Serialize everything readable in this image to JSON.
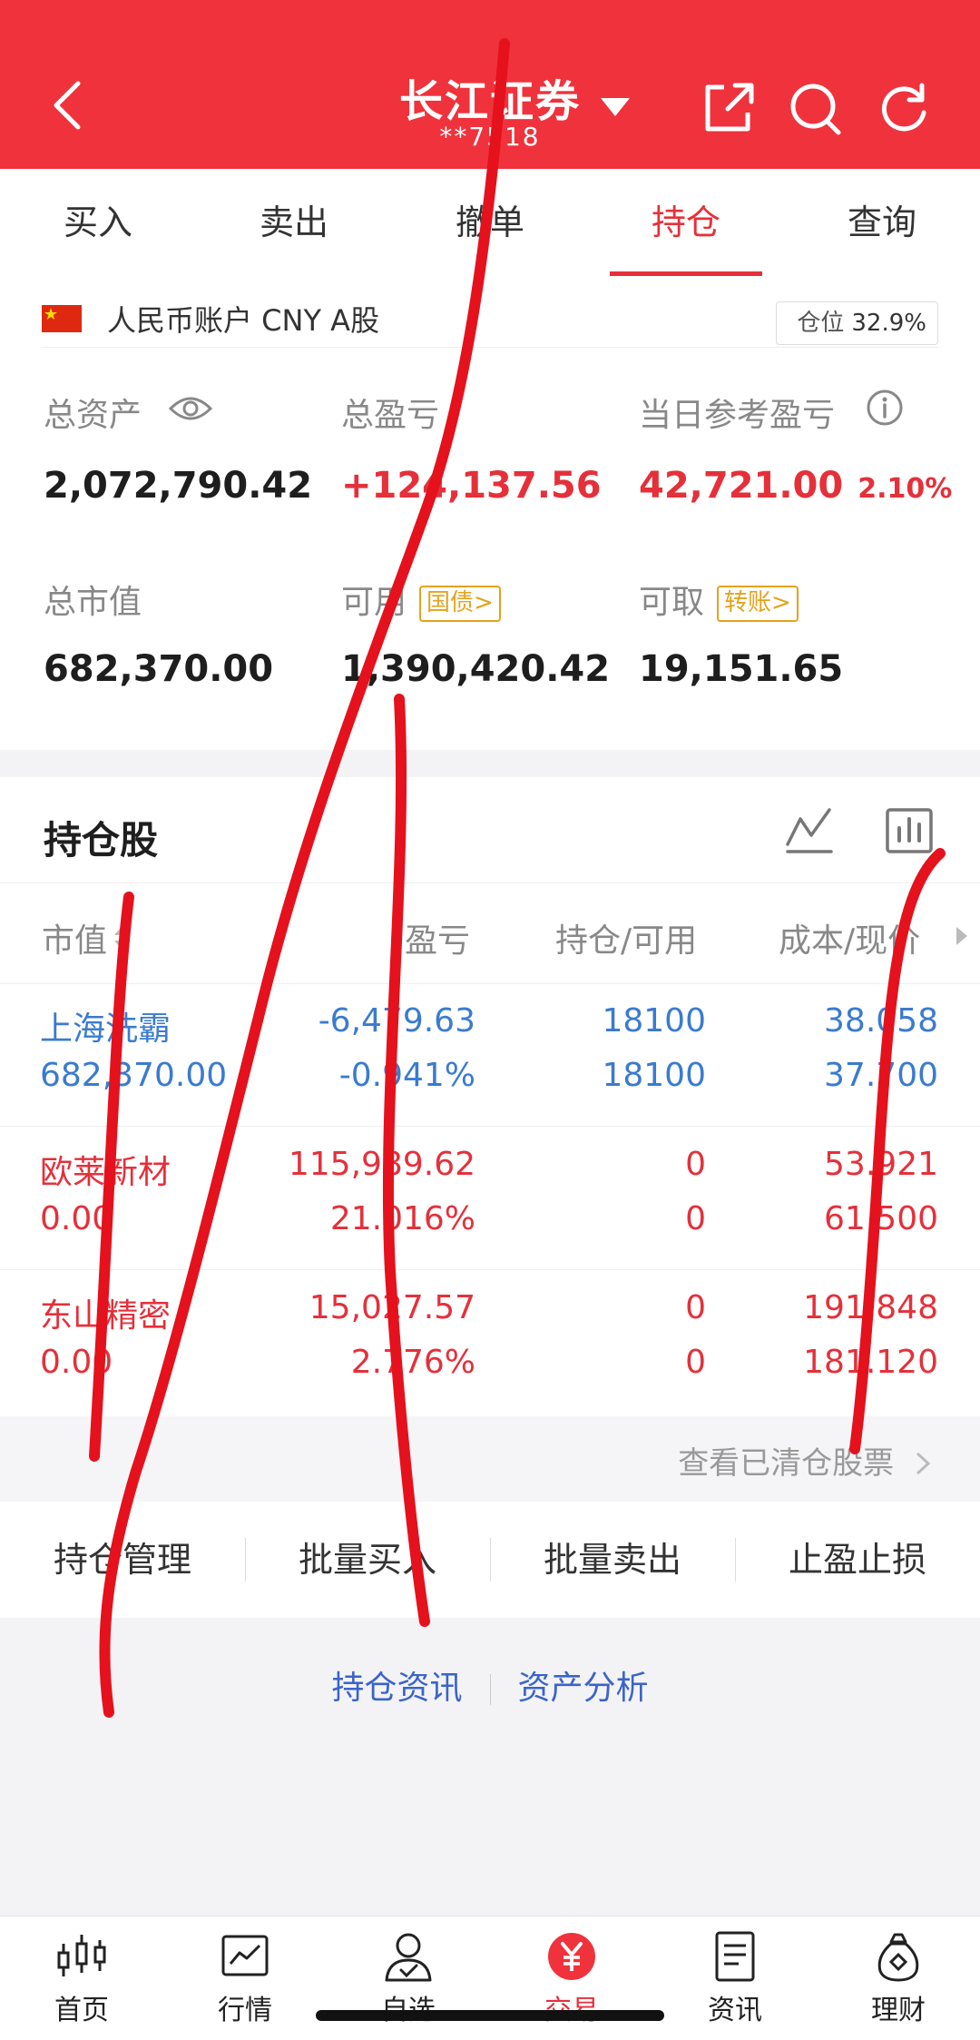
{
  "header": {
    "title": "长江证券",
    "subtitle": "**7518"
  },
  "tabs": [
    {
      "label": "买入"
    },
    {
      "label": "卖出"
    },
    {
      "label": "撤单"
    },
    {
      "label": "持仓"
    },
    {
      "label": "查询"
    }
  ],
  "account": {
    "label": "人民币账户 CNY A股",
    "position_label": "仓位",
    "position_value": "32.9%",
    "total_assets_label": "总资产",
    "total_assets": "2,072,790.42",
    "total_pl_label": "总盈亏",
    "total_pl": "+124,137.56",
    "daily_pl_label": "当日参考盈亏",
    "daily_pl": "42,721.00",
    "daily_pl_pct": "2.10%",
    "market_value_label": "总市值",
    "market_value": "682,370.00",
    "available_label": "可用",
    "available_tag": "国债>",
    "available": "1,390,420.42",
    "withdrawable_label": "可取",
    "withdrawable_tag": "转账>",
    "withdrawable": "19,151.65"
  },
  "holdings": {
    "title": "持仓股",
    "columns": [
      "市值",
      "盈亏",
      "持仓/可用",
      "成本/现价"
    ],
    "rows": [
      {
        "name": "上海洗霸",
        "market_value": "682,370.00",
        "pl": "-6,479.63",
        "pl_pct": "-0.941%",
        "hold": "18100",
        "avail": "18100",
        "cost": "38.058",
        "price": "37.700",
        "color": "#3a7bcf"
      },
      {
        "name": "欧莱新材",
        "market_value": "0.00",
        "pl": "115,989.62",
        "pl_pct": "21.016%",
        "hold": "0",
        "avail": "0",
        "cost": "53.921",
        "price": "61.500",
        "color": "#e5303a"
      },
      {
        "name": "东山精密",
        "market_value": "0.00",
        "pl": "15,027.57",
        "pl_pct": "2.776%",
        "hold": "0",
        "avail": "0",
        "cost": "191.848",
        "price": "181.120",
        "color": "#e5303a"
      }
    ],
    "cleared_link": "查看已清仓股票"
  },
  "actions": [
    {
      "label": "持仓管理"
    },
    {
      "label": "批量买入"
    },
    {
      "label": "批量卖出"
    },
    {
      "label": "止盈止损"
    }
  ],
  "bottom_links": {
    "news": "持仓资讯",
    "analysis": "资产分析"
  },
  "nav": [
    {
      "label": "首页",
      "icon": "candlestick-icon"
    },
    {
      "label": "行情",
      "icon": "line-chart-icon"
    },
    {
      "label": "自选",
      "icon": "person-check-icon"
    },
    {
      "label": "交易",
      "icon": "yen-icon"
    },
    {
      "label": "资讯",
      "icon": "document-icon"
    },
    {
      "label": "理财",
      "icon": "money-bag-icon"
    }
  ],
  "colors": {
    "brand_red": "#f0323c",
    "gain_red": "#e5303a",
    "loss_blue": "#3a7bcf",
    "link_blue": "#3a64c9",
    "tag_orange": "#e5a21b"
  }
}
